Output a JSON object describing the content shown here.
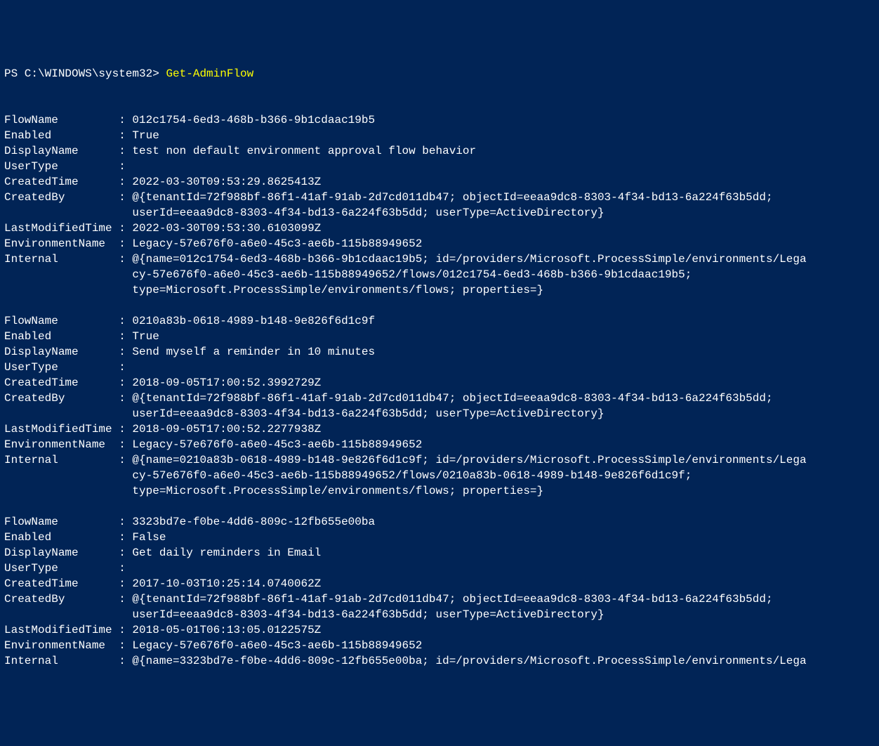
{
  "prompt": {
    "prefix": "PS C:\\WINDOWS\\system32> ",
    "command": "Get-AdminFlow"
  },
  "records": [
    {
      "FlowName": "012c1754-6ed3-468b-b366-9b1cdaac19b5",
      "Enabled": "True",
      "DisplayName": "test non default environment approval flow behavior",
      "UserType": "",
      "CreatedTime": "2022-03-30T09:53:29.8625413Z",
      "CreatedBy": "@{tenantId=72f988bf-86f1-41af-91ab-2d7cd011db47; objectId=eeaa9dc8-8303-4f34-bd13-6a224f63b5dd;\n                   userId=eeaa9dc8-8303-4f34-bd13-6a224f63b5dd; userType=ActiveDirectory}",
      "LastModifiedTime": "2022-03-30T09:53:30.6103099Z",
      "EnvironmentName": "Legacy-57e676f0-a6e0-45c3-ae6b-115b88949652",
      "Internal": "@{name=012c1754-6ed3-468b-b366-9b1cdaac19b5; id=/providers/Microsoft.ProcessSimple/environments/Lega\n                   cy-57e676f0-a6e0-45c3-ae6b-115b88949652/flows/012c1754-6ed3-468b-b366-9b1cdaac19b5;\n                   type=Microsoft.ProcessSimple/environments/flows; properties=}"
    },
    {
      "FlowName": "0210a83b-0618-4989-b148-9e826f6d1c9f",
      "Enabled": "True",
      "DisplayName": "Send myself a reminder in 10 minutes",
      "UserType": "",
      "CreatedTime": "2018-09-05T17:00:52.3992729Z",
      "CreatedBy": "@{tenantId=72f988bf-86f1-41af-91ab-2d7cd011db47; objectId=eeaa9dc8-8303-4f34-bd13-6a224f63b5dd;\n                   userId=eeaa9dc8-8303-4f34-bd13-6a224f63b5dd; userType=ActiveDirectory}",
      "LastModifiedTime": "2018-09-05T17:00:52.2277938Z",
      "EnvironmentName": "Legacy-57e676f0-a6e0-45c3-ae6b-115b88949652",
      "Internal": "@{name=0210a83b-0618-4989-b148-9e826f6d1c9f; id=/providers/Microsoft.ProcessSimple/environments/Lega\n                   cy-57e676f0-a6e0-45c3-ae6b-115b88949652/flows/0210a83b-0618-4989-b148-9e826f6d1c9f;\n                   type=Microsoft.ProcessSimple/environments/flows; properties=}"
    },
    {
      "FlowName": "3323bd7e-f0be-4dd6-809c-12fb655e00ba",
      "Enabled": "False",
      "DisplayName": "Get daily reminders in Email",
      "UserType": "",
      "CreatedTime": "2017-10-03T10:25:14.0740062Z",
      "CreatedBy": "@{tenantId=72f988bf-86f1-41af-91ab-2d7cd011db47; objectId=eeaa9dc8-8303-4f34-bd13-6a224f63b5dd;\n                   userId=eeaa9dc8-8303-4f34-bd13-6a224f63b5dd; userType=ActiveDirectory}",
      "LastModifiedTime": "2018-05-01T06:13:05.0122575Z",
      "EnvironmentName": "Legacy-57e676f0-a6e0-45c3-ae6b-115b88949652",
      "Internal": "@{name=3323bd7e-f0be-4dd6-809c-12fb655e00ba; id=/providers/Microsoft.ProcessSimple/environments/Lega"
    }
  ],
  "fieldOrder": [
    "FlowName",
    "Enabled",
    "DisplayName",
    "UserType",
    "CreatedTime",
    "CreatedBy",
    "LastModifiedTime",
    "EnvironmentName",
    "Internal"
  ],
  "labelWidth": 16
}
